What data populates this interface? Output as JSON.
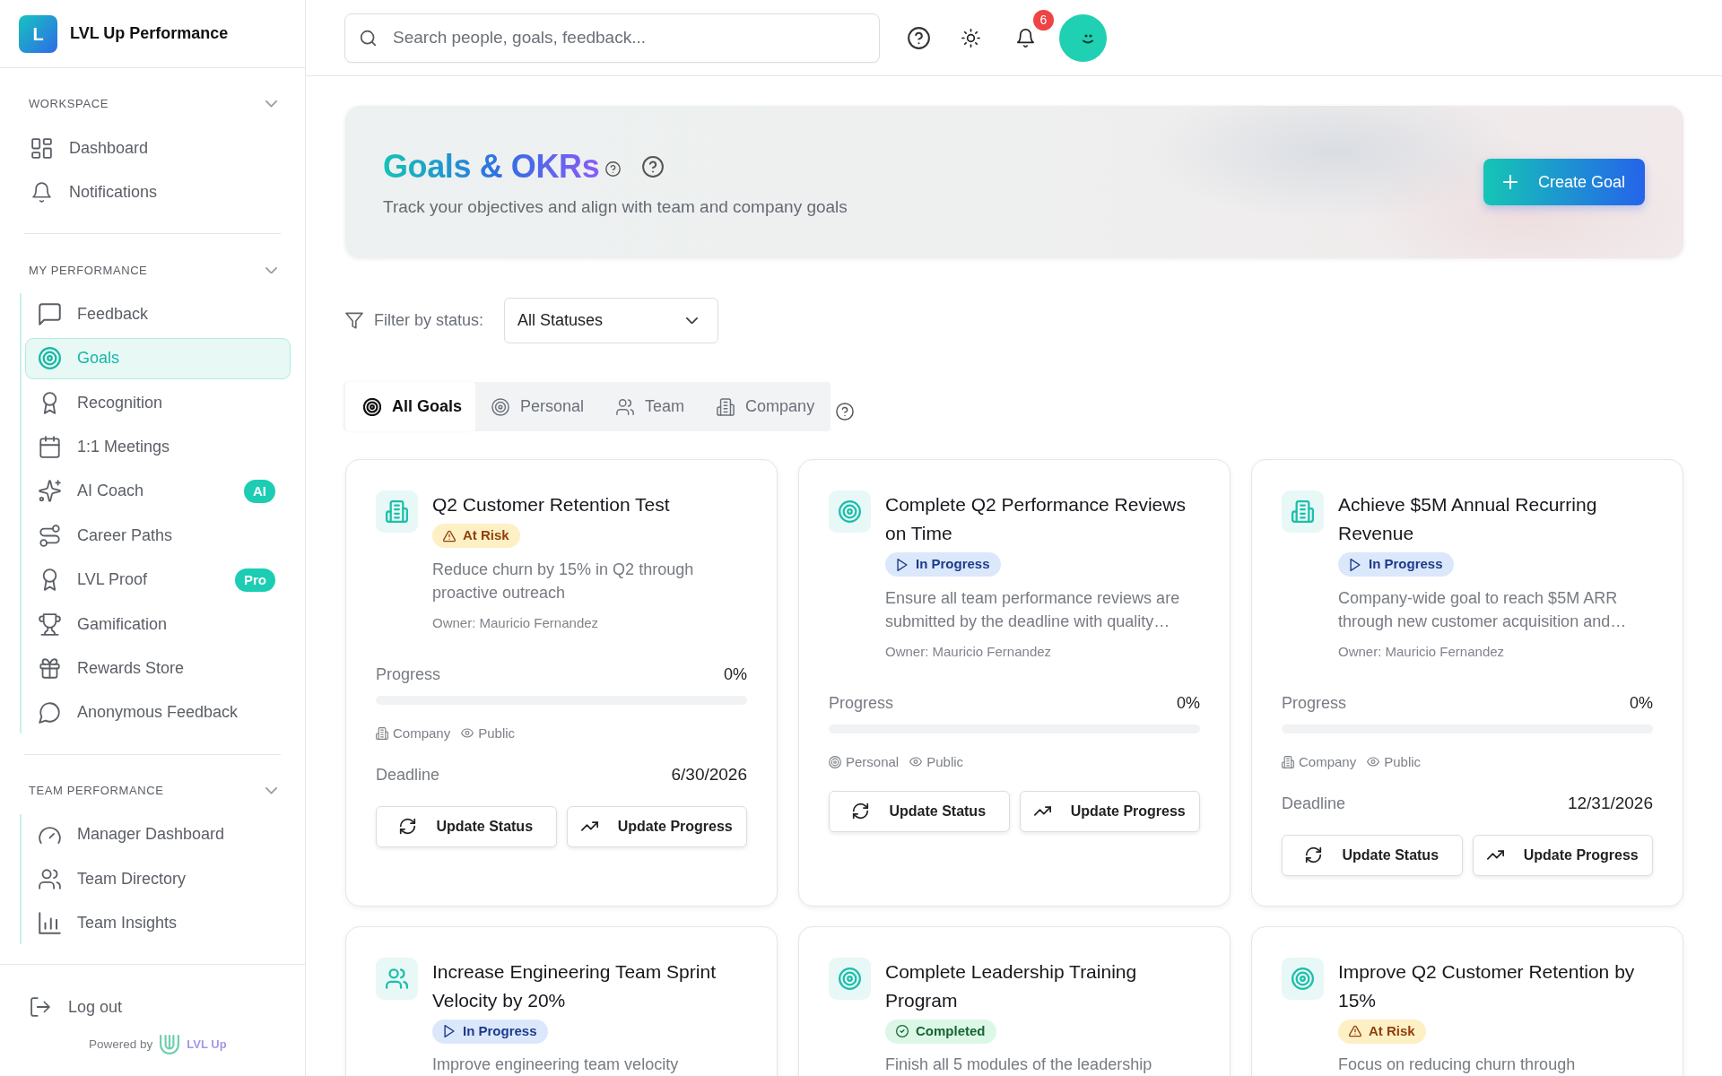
{
  "sidebar": {
    "brand": {
      "logo_letter": "L",
      "name": "LVL Up Performance"
    },
    "sections": [
      {
        "kind": "plain",
        "title": "WORKSPACE",
        "expanded": true,
        "items": [
          {
            "label": "Dashboard",
            "selected": false
          },
          {
            "label": "Notifications",
            "selected": false
          }
        ]
      },
      {
        "kind": "nested",
        "title": "MY PERFORMANCE",
        "expanded": true,
        "items": [
          {
            "label": "Feedback",
            "selected": false
          },
          {
            "label": "Goals",
            "selected": true
          },
          {
            "label": "Recognition",
            "selected": false
          },
          {
            "label": "1:1 Meetings",
            "selected": false
          },
          {
            "label": "AI Coach",
            "selected": false,
            "badge": "AI"
          },
          {
            "label": "Career Paths",
            "selected": false
          },
          {
            "label": "LVL Proof",
            "selected": false,
            "badge": "Pro"
          },
          {
            "label": "Gamification",
            "selected": false
          },
          {
            "label": "Rewards Store",
            "selected": false
          },
          {
            "label": "Anonymous Feedback",
            "selected": false
          }
        ]
      },
      {
        "kind": "nested",
        "title": "TEAM PERFORMANCE",
        "expanded": true,
        "items": [
          {
            "label": "Manager Dashboard",
            "selected": false
          },
          {
            "label": "Team Directory",
            "selected": false
          },
          {
            "label": "Team Insights",
            "selected": false
          }
        ]
      }
    ],
    "footer": {
      "logout": "Log out",
      "powered_by": "Powered by",
      "powered_logo": "LVL Up"
    }
  },
  "topbar": {
    "search": {
      "placeholder": "Search people, goals, feedback..."
    },
    "notification_count": "6"
  },
  "header": {
    "title": "Goals & OKRs",
    "subtitle": "Track your objectives and align with team and company goals",
    "create_button": "Create Goal"
  },
  "filter": {
    "label": "Filter by status:",
    "value": "All Statuses"
  },
  "tabs": [
    {
      "label": "All Goals",
      "selected": true
    },
    {
      "label": "Personal",
      "selected": false
    },
    {
      "label": "Team",
      "selected": false
    },
    {
      "label": "Company",
      "selected": false
    }
  ],
  "goals": [
    {
      "kind": "company",
      "title": "Q2 Customer Retention Test",
      "status": {
        "kind": "at_risk",
        "label": "At Risk"
      },
      "description": "Reduce churn by 15% in Q2 through proactive outreach",
      "owner": "Owner: Mauricio Fernandez",
      "progress_label": "Progress",
      "progress_value": "0%",
      "category": "Company",
      "visibility": "Public",
      "deadline_label": "Deadline",
      "deadline": "6/30/2026",
      "actions": [
        "Update Status",
        "Update Progress"
      ]
    },
    {
      "kind": "personal",
      "title": "Complete Q2 Performance Reviews on Time",
      "status": {
        "kind": "in_progress",
        "label": "In Progress"
      },
      "description": "Ensure all team performance reviews are submitted by the deadline with quality…",
      "owner": "Owner: Mauricio Fernandez",
      "progress_label": "Progress",
      "progress_value": "0%",
      "category": "Personal",
      "visibility": "Public",
      "actions": [
        "Update Status",
        "Update Progress"
      ]
    },
    {
      "kind": "company",
      "title": "Achieve $5M Annual Recurring Revenue",
      "status": {
        "kind": "in_progress",
        "label": "In Progress"
      },
      "description": "Company-wide goal to reach $5M ARR through new customer acquisition and…",
      "owner": "Owner: Mauricio Fernandez",
      "progress_label": "Progress",
      "progress_value": "0%",
      "category": "Company",
      "visibility": "Public",
      "deadline_label": "Deadline",
      "deadline": "12/31/2026",
      "actions": [
        "Update Status",
        "Update Progress"
      ]
    },
    {
      "kind": "team",
      "title": "Increase Engineering Team Sprint Velocity by 20%",
      "status": {
        "kind": "in_progress",
        "label": "In Progress"
      },
      "description": "Improve engineering team velocity"
    },
    {
      "kind": "personal",
      "title": "Complete Leadership Training Program",
      "status": {
        "kind": "completed",
        "label": "Completed"
      },
      "description": "Finish all 5 modules of the leadership"
    },
    {
      "kind": "personal",
      "title": "Improve Q2 Customer Retention by 15%",
      "status": {
        "kind": "at_risk",
        "label": "At Risk"
      },
      "description": "Focus on reducing churn through"
    }
  ]
}
